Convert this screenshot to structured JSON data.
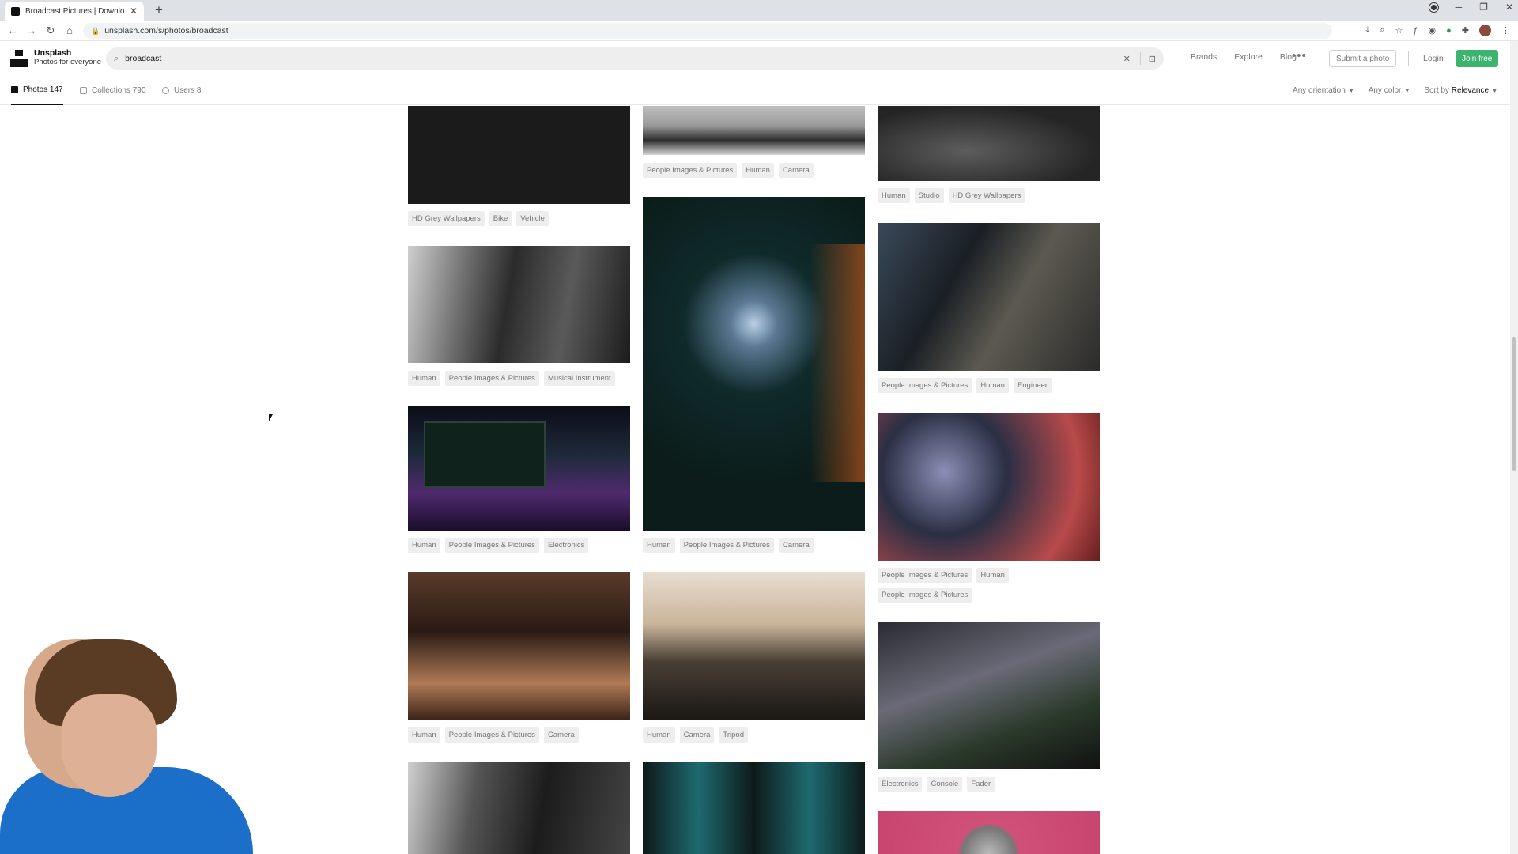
{
  "browser": {
    "tab_title": "Broadcast Pictures | Download F...",
    "new_tab_icon": "plus-icon",
    "url": "unsplash.com/s/photos/broadcast"
  },
  "header": {
    "brand_name": "Unsplash",
    "brand_tagline": "Photos for everyone",
    "search_value": "broadcast",
    "links": [
      "Brands",
      "Explore",
      "Blog"
    ],
    "submit_label": "Submit a photo",
    "login_label": "Login",
    "join_label": "Join free",
    "accent_color": "#3cb46e"
  },
  "subnav": {
    "photos_label": "Photos 147",
    "collections_label": "Collections 790",
    "users_label": "Users 8",
    "orientation": "Any orientation",
    "color": "Any color",
    "sort_prefix": "Sort by",
    "sort_value": "Relevance"
  },
  "columns": {
    "left": [
      {
        "tags": [
          "HD Grey Wallpapers",
          "Bike",
          "Vehicle"
        ]
      },
      {
        "tags": [
          "Human",
          "People Images & Pictures",
          "Musical Instrument"
        ]
      },
      {
        "tags": [
          "Human",
          "People Images & Pictures",
          "Electronics"
        ]
      },
      {
        "tags": [
          "Human",
          "People Images & Pictures",
          "Camera"
        ]
      }
    ],
    "middle": [
      {
        "tags": [
          "People Images & Pictures",
          "Human",
          "Camera"
        ]
      },
      {
        "tags": [
          "Human",
          "People Images & Pictures",
          "Camera"
        ]
      },
      {
        "tags": [
          "Human",
          "Camera",
          "Tripod"
        ]
      }
    ],
    "right": [
      {
        "tags": [
          "Human",
          "Studio",
          "HD Grey Wallpapers"
        ]
      },
      {
        "tags": [
          "People Images & Pictures",
          "Human",
          "Engineer"
        ]
      },
      {
        "tags": [
          "People Images & Pictures",
          "Human",
          "People Images & Pictures"
        ]
      },
      {
        "tags": [
          "Electronics",
          "Console",
          "Fader"
        ]
      }
    ]
  }
}
